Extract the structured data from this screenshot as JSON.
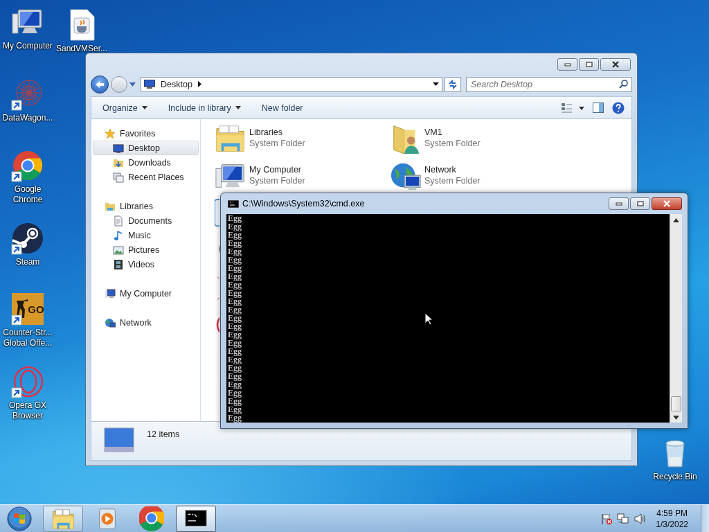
{
  "desktop_icons": [
    {
      "label": "My Computer",
      "kind": "computer",
      "shortcut": false
    },
    {
      "label": "SandVMSer...",
      "kind": "java-file",
      "shortcut": false
    },
    {
      "label": "DataWagon...",
      "kind": "starburst",
      "shortcut": true
    },
    {
      "label": "Google Chrome",
      "kind": "chrome",
      "shortcut": true
    },
    {
      "label": "Steam",
      "kind": "steam",
      "shortcut": true
    },
    {
      "label": "Counter-Str... Global Offe...",
      "kind": "game",
      "logo_text": "GO",
      "shortcut": true
    },
    {
      "label": "Opera GX Browser",
      "kind": "ring",
      "shortcut": true
    },
    {
      "label": "Recycle Bin",
      "kind": "recycle",
      "shortcut": false
    }
  ],
  "explorer": {
    "address": "Desktop",
    "search": {
      "placeholder": "Search Desktop"
    },
    "toolbar": [
      {
        "label": "Organize",
        "dropdown": true
      },
      {
        "label": "Include in library",
        "dropdown": true
      },
      {
        "label": "New folder",
        "dropdown": false
      }
    ],
    "nav": [
      {
        "label": "Favorites",
        "kind": "star",
        "children": [
          {
            "label": "Desktop",
            "kind": "desktop",
            "selected": true
          },
          {
            "label": "Downloads",
            "kind": "downloads",
            "selected": false
          },
          {
            "label": "Recent Places",
            "kind": "recent",
            "selected": false
          }
        ]
      },
      {
        "label": "Libraries",
        "kind": "libraries",
        "children": [
          {
            "label": "Documents",
            "kind": "documents",
            "selected": false
          },
          {
            "label": "Music",
            "kind": "music",
            "selected": false
          },
          {
            "label": "Pictures",
            "kind": "pictures",
            "selected": false
          },
          {
            "label": "Videos",
            "kind": "videos",
            "selected": false
          }
        ]
      },
      {
        "label": "My Computer",
        "kind": "computer"
      },
      {
        "label": "Network",
        "kind": "network"
      }
    ],
    "items": [
      {
        "name": "Libraries",
        "type": "System Folder",
        "kind": "libraries"
      },
      {
        "name": "VM1",
        "type": "System Folder",
        "kind": "user-folder"
      },
      {
        "name": "My Computer",
        "type": "System Folder",
        "kind": "computer"
      },
      {
        "name": "Network",
        "type": "System Folder",
        "kind": "network"
      },
      {
        "kind": "app-shortcut"
      },
      {
        "kind": "empty"
      },
      {
        "kind": "dark-shortcut"
      },
      {
        "kind": "empty"
      },
      {
        "kind": "starburst-shortcut"
      },
      {
        "kind": "empty"
      },
      {
        "kind": "ring-shortcut"
      }
    ],
    "status": "12 items"
  },
  "cmd": {
    "title": "C:\\Windows\\System32\\cmd.exe",
    "lines": [
      "Egg",
      "Egg",
      "Egg",
      "Egg",
      "Egg",
      "Egg",
      "Egg",
      "Egg",
      "Egg",
      "Egg",
      "Egg",
      "Egg",
      "Egg",
      "Egg",
      "Egg",
      "Egg",
      "Egg",
      "Egg",
      "Egg",
      "Egg",
      "Egg",
      "Egg",
      "Egg",
      "Egg",
      "Egg"
    ]
  },
  "taskbar": {
    "apps": [
      {
        "kind": "explorer",
        "open": true,
        "selected": false
      },
      {
        "kind": "media",
        "open": false,
        "selected": false
      },
      {
        "kind": "chrome",
        "open": false,
        "selected": false
      },
      {
        "kind": "cmd",
        "open": true,
        "selected": true
      }
    ],
    "clock": {
      "time": "4:59 PM",
      "date": "1/3/2022"
    }
  }
}
